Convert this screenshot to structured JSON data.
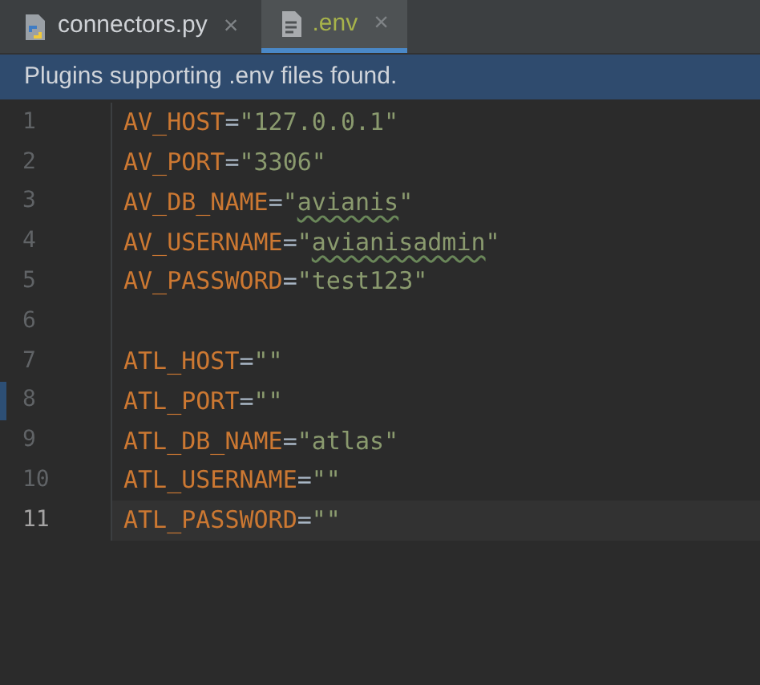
{
  "tabs": [
    {
      "label": "connectors.py",
      "kind": "python",
      "selected": false,
      "close": "×"
    },
    {
      "label": ".env",
      "kind": "text",
      "selected": true,
      "close": "×"
    }
  ],
  "banner": "Plugins supporting .env files found.",
  "lines": [
    {
      "number": "1",
      "current": false,
      "marked": false,
      "tokens": [
        {
          "kind": "key",
          "text": "AV_HOST"
        },
        {
          "kind": "op",
          "text": "="
        },
        {
          "kind": "string",
          "text": "\"127.0.0.1\"",
          "typo": false
        }
      ]
    },
    {
      "number": "2",
      "current": false,
      "marked": false,
      "tokens": [
        {
          "kind": "key",
          "text": "AV_PORT"
        },
        {
          "kind": "op",
          "text": "="
        },
        {
          "kind": "string",
          "text": "\"3306\"",
          "typo": false
        }
      ]
    },
    {
      "number": "3",
      "current": false,
      "marked": false,
      "tokens": [
        {
          "kind": "key",
          "text": "AV_DB_NAME"
        },
        {
          "kind": "op",
          "text": "="
        },
        {
          "kind": "string",
          "text": "\"",
          "typo": false
        },
        {
          "kind": "string",
          "text": "avianis",
          "typo": true
        },
        {
          "kind": "string",
          "text": "\"",
          "typo": false
        }
      ]
    },
    {
      "number": "4",
      "current": false,
      "marked": false,
      "tokens": [
        {
          "kind": "key",
          "text": "AV_USERNAME"
        },
        {
          "kind": "op",
          "text": "="
        },
        {
          "kind": "string",
          "text": "\"",
          "typo": false
        },
        {
          "kind": "string",
          "text": "avianisadmin",
          "typo": true
        },
        {
          "kind": "string",
          "text": "\"",
          "typo": false
        }
      ]
    },
    {
      "number": "5",
      "current": false,
      "marked": false,
      "tokens": [
        {
          "kind": "key",
          "text": "AV_PASSWORD"
        },
        {
          "kind": "op",
          "text": "="
        },
        {
          "kind": "string",
          "text": "\"test123\"",
          "typo": false
        }
      ]
    },
    {
      "number": "6",
      "current": false,
      "marked": false
    },
    {
      "number": "7",
      "current": false,
      "marked": false,
      "tokens": [
        {
          "kind": "key",
          "text": "ATL_HOST"
        },
        {
          "kind": "op",
          "text": "="
        },
        {
          "kind": "string",
          "text": "\"\"",
          "typo": false
        }
      ]
    },
    {
      "number": "8",
      "current": false,
      "marked": true,
      "tokens": [
        {
          "kind": "key",
          "text": "ATL_PORT"
        },
        {
          "kind": "op",
          "text": "="
        },
        {
          "kind": "string",
          "text": "\"\"",
          "typo": false
        }
      ]
    },
    {
      "number": "9",
      "current": false,
      "marked": false,
      "tokens": [
        {
          "kind": "key",
          "text": "ATL_DB_NAME"
        },
        {
          "kind": "op",
          "text": "="
        },
        {
          "kind": "string",
          "text": "\"atlas\"",
          "typo": false
        }
      ]
    },
    {
      "number": "10",
      "current": false,
      "marked": false,
      "tokens": [
        {
          "kind": "key",
          "text": "ATL_USERNAME"
        },
        {
          "kind": "op",
          "text": "="
        },
        {
          "kind": "string",
          "text": "\"\"",
          "typo": false
        }
      ]
    },
    {
      "number": "11",
      "current": true,
      "marked": false,
      "tokens": [
        {
          "kind": "key",
          "text": "ATL_PASSWORD"
        },
        {
          "kind": "op",
          "text": "="
        },
        {
          "kind": "string",
          "text": "\"\"",
          "typo": false
        }
      ]
    }
  ]
}
